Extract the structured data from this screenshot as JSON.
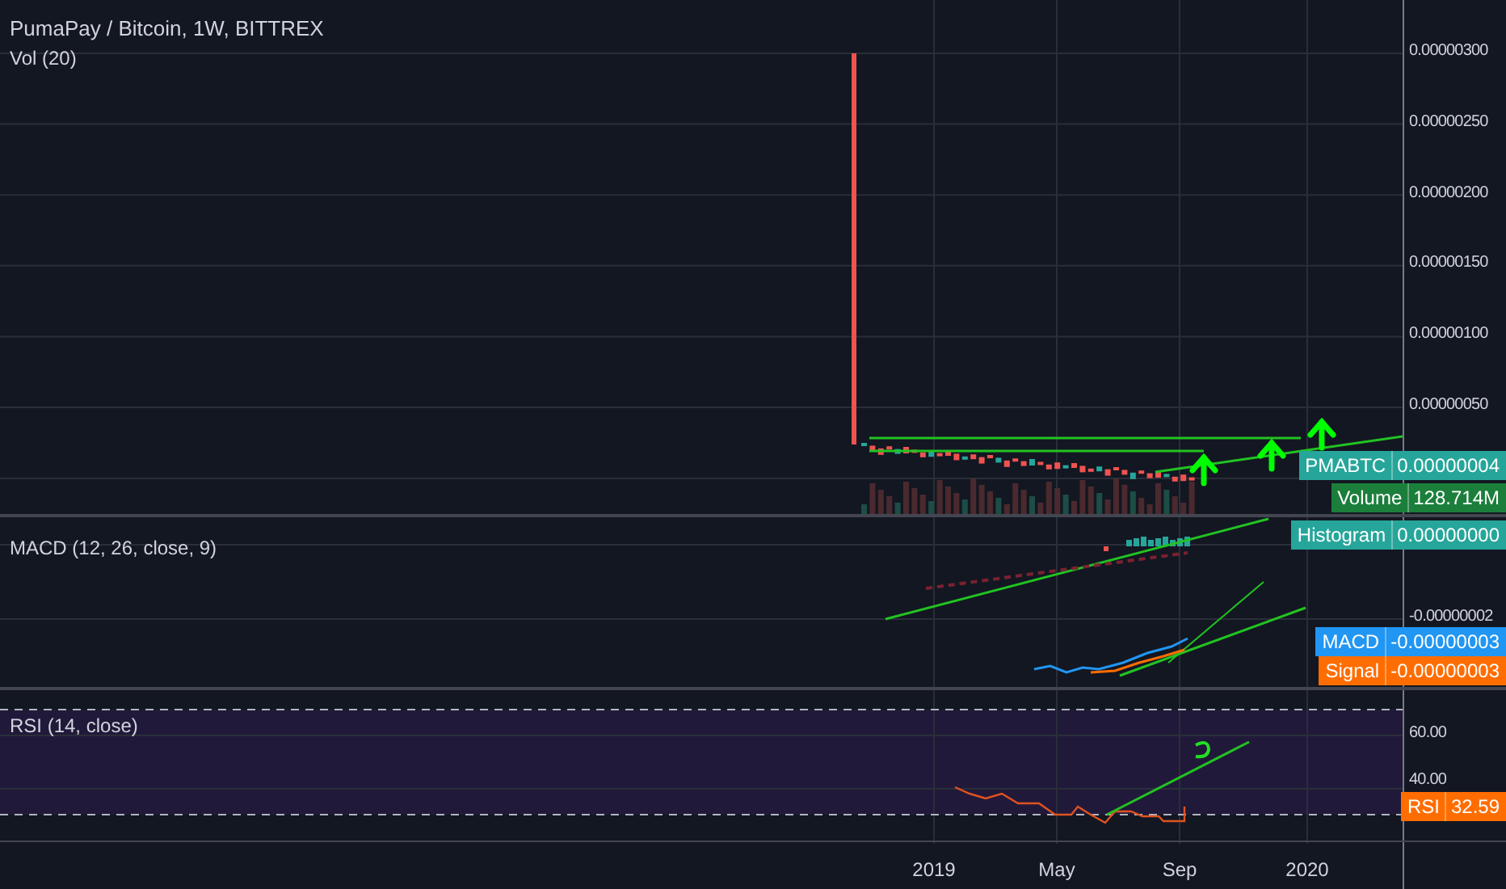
{
  "main_pane": {
    "title": "PumaPay / Bitcoin, 1W, BITTREX",
    "volume_legend": "Vol (20)",
    "axis_ticks": [
      "0.00000300",
      "0.00000250",
      "0.00000200",
      "0.00000150",
      "0.00000100",
      "0.00000050"
    ],
    "labels": [
      {
        "name": "PMABTC",
        "value": "0.00000004",
        "color": "#26a69a"
      },
      {
        "name": "Volume",
        "value": "128.714M",
        "color": "#1b7f3b"
      }
    ]
  },
  "macd_pane": {
    "legend": "MACD (12, 26, close, 9)",
    "axis_ticks": [
      "-0.00000002"
    ],
    "labels": [
      {
        "name": "Histogram",
        "value": "0.00000000",
        "color": "#26a69a"
      },
      {
        "name": "MACD",
        "value": "-0.00000003",
        "color": "#2196f3"
      },
      {
        "name": "Signal",
        "value": "-0.00000003",
        "color": "#ff6d00"
      }
    ]
  },
  "rsi_pane": {
    "legend": "RSI (14, close)",
    "axis_ticks": [
      "60.00",
      "40.00"
    ],
    "labels": [
      {
        "name": "RSI",
        "value": "32.59",
        "color": "#ff6d00"
      }
    ]
  },
  "time_axis": [
    "2019",
    "May",
    "Sep",
    "2020"
  ]
}
